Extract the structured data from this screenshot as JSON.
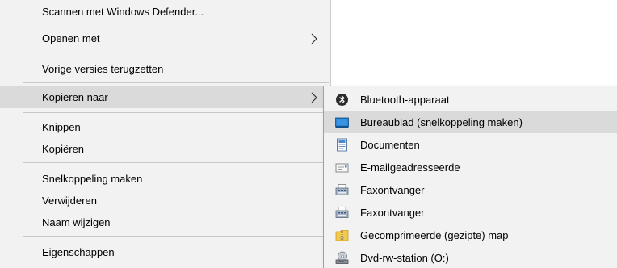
{
  "context_menu": {
    "items": [
      {
        "label": "Scannen met Windows Defender..."
      },
      {
        "label": "Openen met"
      },
      {
        "label": "Vorige versies terugzetten"
      },
      {
        "label": "Kopiëren naar"
      },
      {
        "label": "Knippen"
      },
      {
        "label": "Kopiëren"
      },
      {
        "label": "Snelkoppeling maken"
      },
      {
        "label": "Verwijderen"
      },
      {
        "label": "Naam wijzigen"
      },
      {
        "label": "Eigenschappen"
      }
    ]
  },
  "submenu": {
    "items": [
      {
        "label": "Bluetooth-apparaat",
        "icon": "bluetooth-icon"
      },
      {
        "label": "Bureaublad (snelkoppeling maken)",
        "icon": "desktop-icon"
      },
      {
        "label": "Documenten",
        "icon": "documents-icon"
      },
      {
        "label": "E-mailgeadresseerde",
        "icon": "mail-recipient-icon"
      },
      {
        "label": "Faxontvanger",
        "icon": "fax-icon"
      },
      {
        "label": "Faxontvanger",
        "icon": "fax-icon"
      },
      {
        "label": "Gecomprimeerde (gezipte) map",
        "icon": "zip-folder-icon"
      },
      {
        "label": "Dvd-rw-station (O:)",
        "icon": "dvd-drive-icon"
      }
    ]
  },
  "colors": {
    "menu_background": "#f2f2f2",
    "highlight": "#dadada",
    "separator": "#c8c8c8",
    "desktop_blue": "#1e73be"
  }
}
